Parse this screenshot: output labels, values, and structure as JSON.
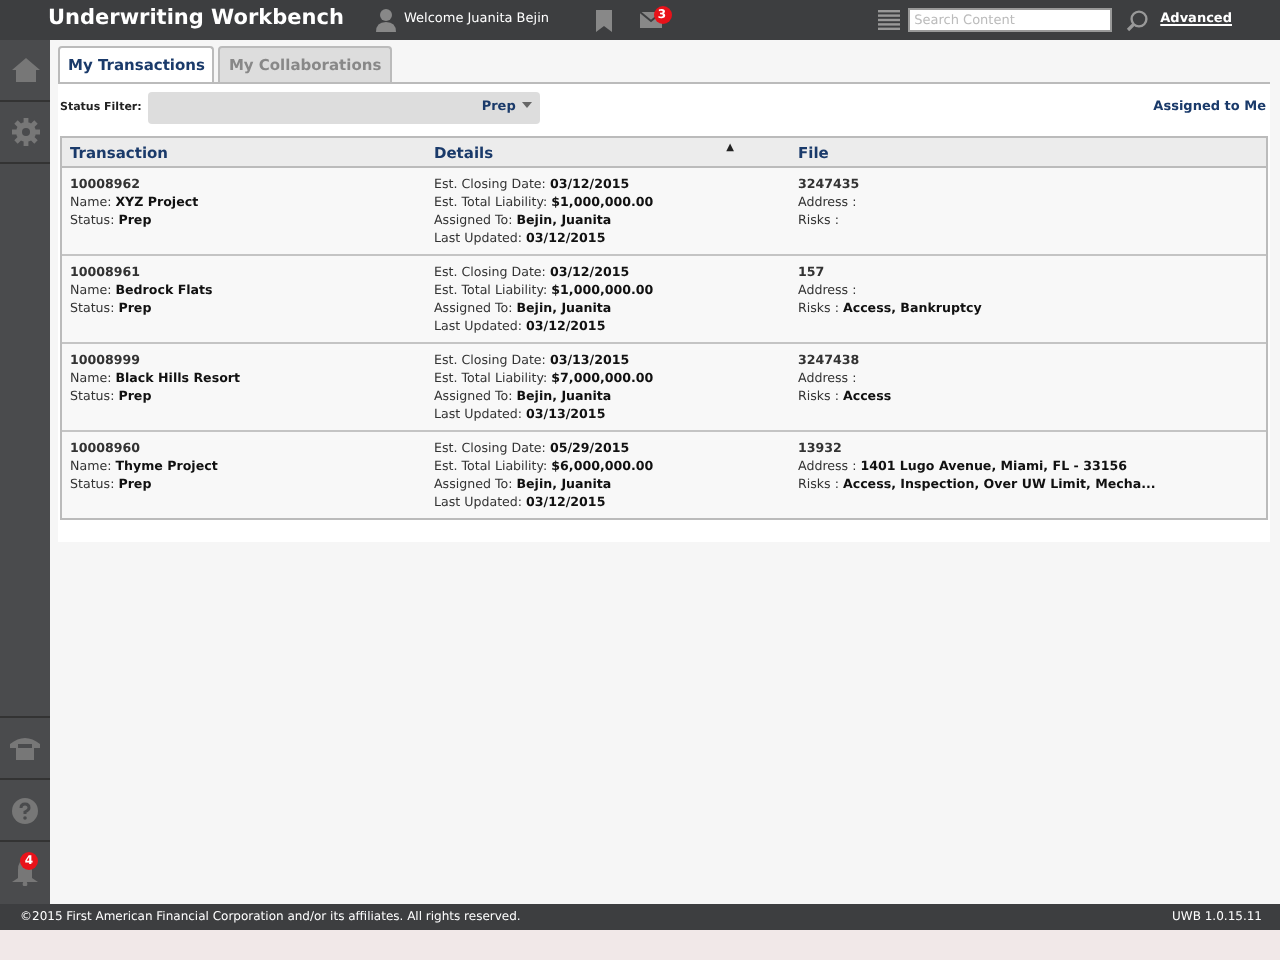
{
  "app": {
    "title": "Underwriting Workbench",
    "welcome": "Welcome Juanita Bejin",
    "mail_badge": "3",
    "search": {
      "placeholder": "Search Content"
    },
    "advanced": "Advanced"
  },
  "sidebar": {
    "bell_badge": "4"
  },
  "tabs": [
    {
      "label": "My Transactions",
      "selected": true
    },
    {
      "label": "My Collaborations",
      "selected": false
    }
  ],
  "filter": {
    "label": "Status Filter:",
    "value": "Prep",
    "assigned": "Assigned to Me"
  },
  "table": {
    "columns": [
      "Transaction",
      "Details",
      "File"
    ],
    "sort_indicator": "▲",
    "rows": [
      {
        "transaction": {
          "id": "10008962",
          "fields": [
            {
              "label": "Name:",
              "value": "XYZ Project"
            },
            {
              "label": "Status:",
              "value": "Prep"
            }
          ]
        },
        "details": [
          {
            "label": "Est. Closing Date:",
            "value": "03/12/2015"
          },
          {
            "label": "Est. Total Liability:",
            "value": "$1,000,000.00"
          },
          {
            "label": "Assigned To:",
            "value": "Bejin, Juanita"
          },
          {
            "label": "Last Updated:",
            "value": "03/12/2015"
          }
        ],
        "file": {
          "id": "3247435",
          "fields": [
            {
              "label": "Address :"
            },
            {
              "label": "Risks :"
            }
          ]
        }
      },
      {
        "transaction": {
          "id": "10008961",
          "fields": [
            {
              "label": "Name:",
              "value": "Bedrock Flats"
            },
            {
              "label": "Status:",
              "value": "Prep"
            }
          ]
        },
        "details": [
          {
            "label": "Est. Closing Date:",
            "value": "03/12/2015"
          },
          {
            "label": "Est. Total Liability:",
            "value": "$1,000,000.00"
          },
          {
            "label": "Assigned To:",
            "value": "Bejin, Juanita"
          },
          {
            "label": "Last Updated:",
            "value": "03/12/2015"
          }
        ],
        "file": {
          "id": "157",
          "fields": [
            {
              "label": "Address :"
            },
            {
              "label": "Risks :",
              "value": "Access, Bankruptcy"
            }
          ]
        }
      },
      {
        "transaction": {
          "id": "10008999",
          "fields": [
            {
              "label": "Name:",
              "value": "Black Hills Resort"
            },
            {
              "label": "Status:",
              "value": "Prep"
            }
          ]
        },
        "details": [
          {
            "label": "Est. Closing Date:",
            "value": "03/13/2015"
          },
          {
            "label": "Est. Total Liability:",
            "value": "$7,000,000.00"
          },
          {
            "label": "Assigned To:",
            "value": "Bejin, Juanita"
          },
          {
            "label": "Last Updated:",
            "value": "03/13/2015"
          }
        ],
        "file": {
          "id": "3247438",
          "fields": [
            {
              "label": "Address :"
            },
            {
              "label": "Risks :",
              "value": "Access"
            }
          ]
        }
      },
      {
        "transaction": {
          "id": "10008960",
          "fields": [
            {
              "label": "Name:",
              "value": "Thyme Project"
            },
            {
              "label": "Status:",
              "value": "Prep"
            }
          ]
        },
        "details": [
          {
            "label": "Est. Closing Date:",
            "value": "05/29/2015"
          },
          {
            "label": "Est. Total Liability:",
            "value": "$6,000,000.00"
          },
          {
            "label": "Assigned To:",
            "value": "Bejin, Juanita"
          },
          {
            "label": "Last Updated:",
            "value": "03/12/2015"
          }
        ],
        "file": {
          "id": "13932",
          "fields": [
            {
              "label": "Address :",
              "value": "1401 Lugo Avenue, Miami, FL - 33156"
            },
            {
              "label": "Risks :",
              "value": "Access, Inspection, Over UW Limit, Mecha..."
            }
          ]
        }
      }
    ]
  },
  "footer": {
    "copyright": "©2015 First American Financial Corporation and/or its affiliates. All rights reserved.",
    "version": "UWB 1.0.15.11"
  }
}
